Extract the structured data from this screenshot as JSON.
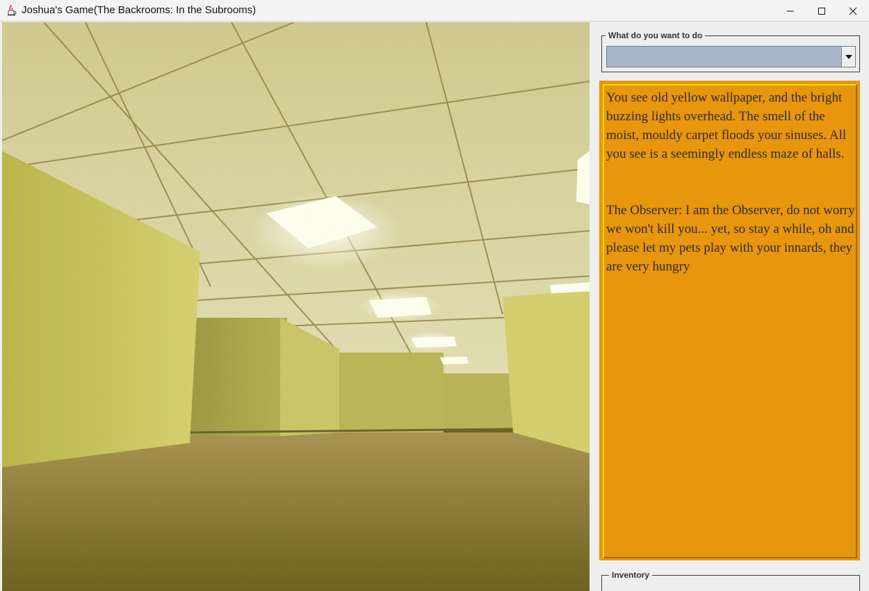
{
  "window": {
    "title": "Joshua's Game(The Backrooms: In the Subrooms)",
    "app_icon": "java-cup-icon",
    "controls": [
      "minimize-icon",
      "maximize-icon",
      "close-icon"
    ]
  },
  "scene": {
    "description_icon": "backrooms-hallway-image",
    "colors": {
      "wall": "#c8c562",
      "ceiling": "#d8d39a",
      "carpet": "#8a7830",
      "light": "#ffffff"
    }
  },
  "action_panel": {
    "legend": "What do you want to do",
    "selected_value": "",
    "dropdown_icon": "chevron-down-icon",
    "combo_color": "#a6b7cb"
  },
  "story": {
    "text": "You see old yellow wallpaper, and the bright buzzing lights overhead. The smell of the moist, mouldy carpet floods your sinuses. All you see is a seemingly endless maze of halls.\n\n\nThe Observer: I am the Observer, do not worry we won't kill you... yet, so stay a while, oh and please let my pets play with your innards, they are very hungry",
    "background": "#e8960d"
  },
  "inventory": {
    "legend": "Inventory"
  }
}
